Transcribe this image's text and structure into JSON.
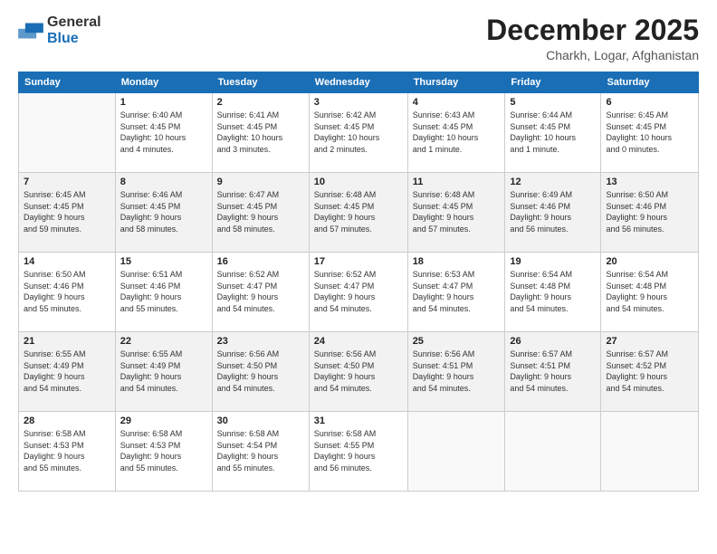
{
  "logo": {
    "general": "General",
    "blue": "Blue"
  },
  "header": {
    "month": "December 2025",
    "location": "Charkh, Logar, Afghanistan"
  },
  "weekdays": [
    "Sunday",
    "Monday",
    "Tuesday",
    "Wednesday",
    "Thursday",
    "Friday",
    "Saturday"
  ],
  "weeks": [
    [
      {
        "day": "",
        "info": ""
      },
      {
        "day": "1",
        "info": "Sunrise: 6:40 AM\nSunset: 4:45 PM\nDaylight: 10 hours\nand 4 minutes."
      },
      {
        "day": "2",
        "info": "Sunrise: 6:41 AM\nSunset: 4:45 PM\nDaylight: 10 hours\nand 3 minutes."
      },
      {
        "day": "3",
        "info": "Sunrise: 6:42 AM\nSunset: 4:45 PM\nDaylight: 10 hours\nand 2 minutes."
      },
      {
        "day": "4",
        "info": "Sunrise: 6:43 AM\nSunset: 4:45 PM\nDaylight: 10 hours\nand 1 minute."
      },
      {
        "day": "5",
        "info": "Sunrise: 6:44 AM\nSunset: 4:45 PM\nDaylight: 10 hours\nand 1 minute."
      },
      {
        "day": "6",
        "info": "Sunrise: 6:45 AM\nSunset: 4:45 PM\nDaylight: 10 hours\nand 0 minutes."
      }
    ],
    [
      {
        "day": "7",
        "info": "Sunrise: 6:45 AM\nSunset: 4:45 PM\nDaylight: 9 hours\nand 59 minutes."
      },
      {
        "day": "8",
        "info": "Sunrise: 6:46 AM\nSunset: 4:45 PM\nDaylight: 9 hours\nand 58 minutes."
      },
      {
        "day": "9",
        "info": "Sunrise: 6:47 AM\nSunset: 4:45 PM\nDaylight: 9 hours\nand 58 minutes."
      },
      {
        "day": "10",
        "info": "Sunrise: 6:48 AM\nSunset: 4:45 PM\nDaylight: 9 hours\nand 57 minutes."
      },
      {
        "day": "11",
        "info": "Sunrise: 6:48 AM\nSunset: 4:45 PM\nDaylight: 9 hours\nand 57 minutes."
      },
      {
        "day": "12",
        "info": "Sunrise: 6:49 AM\nSunset: 4:46 PM\nDaylight: 9 hours\nand 56 minutes."
      },
      {
        "day": "13",
        "info": "Sunrise: 6:50 AM\nSunset: 4:46 PM\nDaylight: 9 hours\nand 56 minutes."
      }
    ],
    [
      {
        "day": "14",
        "info": "Sunrise: 6:50 AM\nSunset: 4:46 PM\nDaylight: 9 hours\nand 55 minutes."
      },
      {
        "day": "15",
        "info": "Sunrise: 6:51 AM\nSunset: 4:46 PM\nDaylight: 9 hours\nand 55 minutes."
      },
      {
        "day": "16",
        "info": "Sunrise: 6:52 AM\nSunset: 4:47 PM\nDaylight: 9 hours\nand 54 minutes."
      },
      {
        "day": "17",
        "info": "Sunrise: 6:52 AM\nSunset: 4:47 PM\nDaylight: 9 hours\nand 54 minutes."
      },
      {
        "day": "18",
        "info": "Sunrise: 6:53 AM\nSunset: 4:47 PM\nDaylight: 9 hours\nand 54 minutes."
      },
      {
        "day": "19",
        "info": "Sunrise: 6:54 AM\nSunset: 4:48 PM\nDaylight: 9 hours\nand 54 minutes."
      },
      {
        "day": "20",
        "info": "Sunrise: 6:54 AM\nSunset: 4:48 PM\nDaylight: 9 hours\nand 54 minutes."
      }
    ],
    [
      {
        "day": "21",
        "info": "Sunrise: 6:55 AM\nSunset: 4:49 PM\nDaylight: 9 hours\nand 54 minutes."
      },
      {
        "day": "22",
        "info": "Sunrise: 6:55 AM\nSunset: 4:49 PM\nDaylight: 9 hours\nand 54 minutes."
      },
      {
        "day": "23",
        "info": "Sunrise: 6:56 AM\nSunset: 4:50 PM\nDaylight: 9 hours\nand 54 minutes."
      },
      {
        "day": "24",
        "info": "Sunrise: 6:56 AM\nSunset: 4:50 PM\nDaylight: 9 hours\nand 54 minutes."
      },
      {
        "day": "25",
        "info": "Sunrise: 6:56 AM\nSunset: 4:51 PM\nDaylight: 9 hours\nand 54 minutes."
      },
      {
        "day": "26",
        "info": "Sunrise: 6:57 AM\nSunset: 4:51 PM\nDaylight: 9 hours\nand 54 minutes."
      },
      {
        "day": "27",
        "info": "Sunrise: 6:57 AM\nSunset: 4:52 PM\nDaylight: 9 hours\nand 54 minutes."
      }
    ],
    [
      {
        "day": "28",
        "info": "Sunrise: 6:58 AM\nSunset: 4:53 PM\nDaylight: 9 hours\nand 55 minutes."
      },
      {
        "day": "29",
        "info": "Sunrise: 6:58 AM\nSunset: 4:53 PM\nDaylight: 9 hours\nand 55 minutes."
      },
      {
        "day": "30",
        "info": "Sunrise: 6:58 AM\nSunset: 4:54 PM\nDaylight: 9 hours\nand 55 minutes."
      },
      {
        "day": "31",
        "info": "Sunrise: 6:58 AM\nSunset: 4:55 PM\nDaylight: 9 hours\nand 56 minutes."
      },
      {
        "day": "",
        "info": ""
      },
      {
        "day": "",
        "info": ""
      },
      {
        "day": "",
        "info": ""
      }
    ]
  ]
}
